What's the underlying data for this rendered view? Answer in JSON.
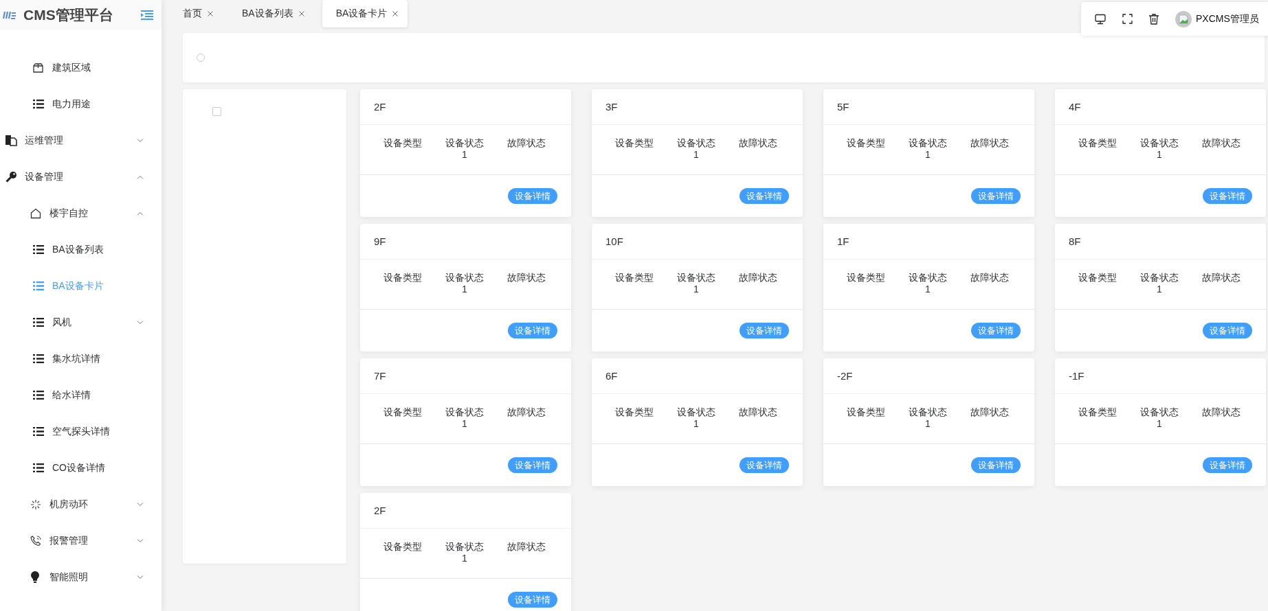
{
  "sidebar": {
    "logo": "CMS管理平台",
    "partial_items": [
      {
        "label": "建筑区域",
        "kind": "box",
        "selected": false
      },
      {
        "label": "电力用途",
        "kind": "list",
        "selected": false
      }
    ],
    "items": [
      {
        "label": "运维管理",
        "kind": "docs",
        "expanded": false
      },
      {
        "label": "设备管理",
        "kind": "key",
        "expanded": true,
        "children": [
          {
            "label": "楼宇自控",
            "kind": "house",
            "expanded": true,
            "children": [
              {
                "label": "BA设备列表",
                "kind": "list",
                "selected": false
              },
              {
                "label": "BA设备卡片",
                "kind": "list",
                "selected": true
              },
              {
                "label": "风机",
                "kind": "list",
                "expanded": false
              },
              {
                "label": "集水坑详情",
                "kind": "list",
                "selected": false
              },
              {
                "label": "给水详情",
                "kind": "list",
                "selected": false
              },
              {
                "label": "空气探头详情",
                "kind": "list",
                "selected": false
              },
              {
                "label": "CO设备详情",
                "kind": "list",
                "selected": false
              }
            ]
          },
          {
            "label": "机房动环",
            "kind": "spinner",
            "expanded": false
          },
          {
            "label": "报警管理",
            "kind": "phone",
            "expanded": false
          },
          {
            "label": "智能照明",
            "kind": "bulb",
            "expanded": false
          }
        ]
      }
    ]
  },
  "tabs": [
    {
      "label": "首页",
      "selected": false
    },
    {
      "label": "BA设备列表",
      "selected": false
    },
    {
      "label": "BA设备卡片",
      "selected": true
    }
  ],
  "user": {
    "name": "PXCMS管理员"
  },
  "filter": {
    "radio_selected": false
  },
  "tree_panel": {
    "checked": false
  },
  "cards": [
    {
      "title": "2F",
      "fields": [
        {
          "label": "设备类型"
        },
        {
          "label": "设备状态",
          "value": "1"
        },
        {
          "label": "故障状态"
        }
      ],
      "button": "设备详情"
    },
    {
      "title": "3F",
      "fields": [
        {
          "label": "设备类型"
        },
        {
          "label": "设备状态",
          "value": "1"
        },
        {
          "label": "故障状态"
        }
      ],
      "button": "设备详情"
    },
    {
      "title": "5F",
      "fields": [
        {
          "label": "设备类型"
        },
        {
          "label": "设备状态",
          "value": "1"
        },
        {
          "label": "故障状态"
        }
      ],
      "button": "设备详情"
    },
    {
      "title": "4F",
      "fields": [
        {
          "label": "设备类型"
        },
        {
          "label": "设备状态",
          "value": "1"
        },
        {
          "label": "故障状态"
        }
      ],
      "button": "设备详情"
    },
    {
      "title": "9F",
      "fields": [
        {
          "label": "设备类型"
        },
        {
          "label": "设备状态",
          "value": "1"
        },
        {
          "label": "故障状态"
        }
      ],
      "button": "设备详情"
    },
    {
      "title": "10F",
      "fields": [
        {
          "label": "设备类型"
        },
        {
          "label": "设备状态",
          "value": "1"
        },
        {
          "label": "故障状态"
        }
      ],
      "button": "设备详情"
    },
    {
      "title": "1F",
      "fields": [
        {
          "label": "设备类型"
        },
        {
          "label": "设备状态",
          "value": "1"
        },
        {
          "label": "故障状态"
        }
      ],
      "button": "设备详情"
    },
    {
      "title": "8F",
      "fields": [
        {
          "label": "设备类型"
        },
        {
          "label": "设备状态",
          "value": "1"
        },
        {
          "label": "故障状态"
        }
      ],
      "button": "设备详情"
    },
    {
      "title": "7F",
      "fields": [
        {
          "label": "设备类型"
        },
        {
          "label": "设备状态",
          "value": "1"
        },
        {
          "label": "故障状态"
        }
      ],
      "button": "设备详情"
    },
    {
      "title": "6F",
      "fields": [
        {
          "label": "设备类型"
        },
        {
          "label": "设备状态",
          "value": "1"
        },
        {
          "label": "故障状态"
        }
      ],
      "button": "设备详情"
    },
    {
      "title": "-2F",
      "fields": [
        {
          "label": "设备类型"
        },
        {
          "label": "设备状态",
          "value": "1"
        },
        {
          "label": "故障状态"
        }
      ],
      "button": "设备详情"
    },
    {
      "title": "-1F",
      "fields": [
        {
          "label": "设备类型"
        },
        {
          "label": "设备状态",
          "value": "1"
        },
        {
          "label": "故障状态"
        }
      ],
      "button": "设备详情"
    },
    {
      "title": "2F",
      "fields": [
        {
          "label": "设备类型"
        },
        {
          "label": "设备状态",
          "value": "1"
        },
        {
          "label": "故障状态"
        }
      ],
      "button": "设备详情"
    }
  ]
}
